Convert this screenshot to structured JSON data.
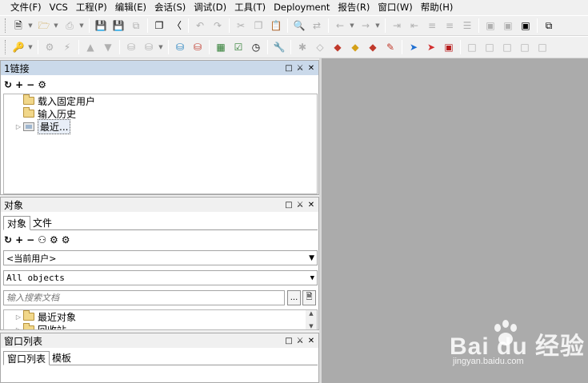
{
  "menubar": {
    "items": [
      {
        "label": "文件(F)"
      },
      {
        "label": "VCS"
      },
      {
        "label": "工程(P)"
      },
      {
        "label": "编辑(E)"
      },
      {
        "label": "会话(S)"
      },
      {
        "label": "调试(D)"
      },
      {
        "label": "工具(T)"
      },
      {
        "label": "Deployment"
      },
      {
        "label": "报告(R)"
      },
      {
        "label": "窗口(W)"
      },
      {
        "label": "帮助(H)"
      }
    ]
  },
  "connections_pane": {
    "title": "1链接",
    "tree": [
      {
        "label": "载入固定用户"
      },
      {
        "label": "输入历史"
      },
      {
        "label": "最近..."
      }
    ]
  },
  "objects_pane": {
    "title": "对象",
    "tabs": [
      {
        "label": "对象"
      },
      {
        "label": "文件"
      }
    ],
    "owner_combo": {
      "value": "<当前用户>"
    },
    "type_combo": {
      "value": "All objects"
    },
    "search": {
      "placeholder": "输入搜索文档"
    },
    "browse_button": {
      "label": "..."
    },
    "tree": [
      {
        "label": "最近对象"
      },
      {
        "label": "回收站"
      }
    ]
  },
  "windows_pane": {
    "title": "窗口列表",
    "tabs": [
      {
        "label": "窗口列表"
      },
      {
        "label": "模板"
      }
    ]
  },
  "watermark": {
    "main": "Bai du 经验",
    "sub": "jingyan.baidu.com"
  },
  "colors": {
    "active_header": "#cad9ea",
    "mdi_background": "#ababab",
    "folder": "#f1d78a"
  }
}
